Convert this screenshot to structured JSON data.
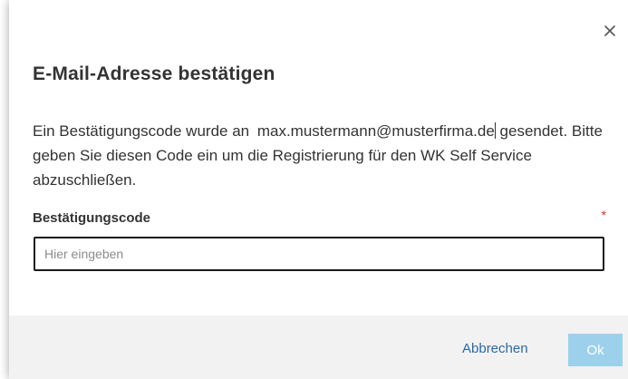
{
  "dialog": {
    "title": "E-Mail-Adresse bestätigen",
    "message_prefix": "Ein Bestätigungscode wurde an",
    "email": "max.mustermann@musterfirma.de",
    "message_suffix": "gesendet. Bitte geben Sie diesen Code ein um die Registrierung für den WK Self Service abzuschließen.",
    "close_icon": "close-icon"
  },
  "form": {
    "code_label": "Bestätigungscode",
    "required_marker": "*",
    "code_placeholder": "Hier eingeben",
    "code_value": ""
  },
  "footer": {
    "cancel_label": "Abbrechen",
    "ok_label": "Ok"
  },
  "colors": {
    "accent_link": "#2b6aa0",
    "ok_disabled_bg": "#9dd0ea",
    "required": "#d0342c",
    "footer_bg": "#f2f2f2"
  }
}
